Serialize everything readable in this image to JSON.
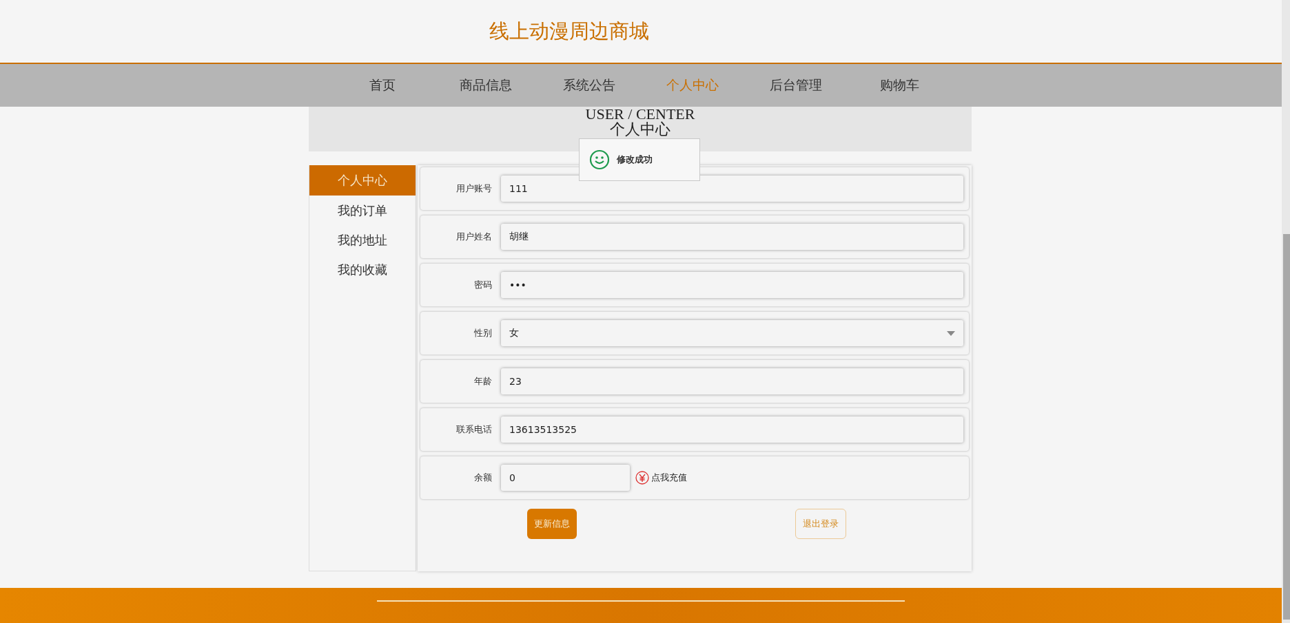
{
  "site_title": "线上动漫周边商城",
  "nav": [
    {
      "label": "首页",
      "selected": false
    },
    {
      "label": "商品信息",
      "selected": false
    },
    {
      "label": "系统公告",
      "selected": false
    },
    {
      "label": "个人中心",
      "selected": true
    },
    {
      "label": "后台管理",
      "selected": false
    },
    {
      "label": "购物车",
      "selected": false
    }
  ],
  "banner": {
    "title_en": "USER / CENTER",
    "title": "个人中心"
  },
  "toast": {
    "message": "修改成功"
  },
  "sidebar": [
    {
      "label": "个人中心",
      "selected": true
    },
    {
      "label": "我的订单",
      "selected": false
    },
    {
      "label": "我的地址",
      "selected": false
    },
    {
      "label": "我的收藏",
      "selected": false
    }
  ],
  "fields": [
    {
      "label": "用户账号",
      "kind": "text",
      "value": "111"
    },
    {
      "label": "用户姓名",
      "kind": "text",
      "value": "胡继"
    },
    {
      "label": "密码",
      "kind": "password",
      "value": "•••"
    },
    {
      "label": "性别",
      "kind": "select",
      "value": "女"
    },
    {
      "label": "年龄",
      "kind": "text",
      "value": "23"
    },
    {
      "label": "联系电话",
      "kind": "text",
      "value": "13613513525"
    },
    {
      "label": "余额",
      "kind": "balance",
      "value": "0",
      "action": "点我充值"
    }
  ],
  "buttons": [
    {
      "label": "更新信息",
      "kind": "primary"
    },
    {
      "label": "退出登录",
      "kind": "outline"
    }
  ]
}
